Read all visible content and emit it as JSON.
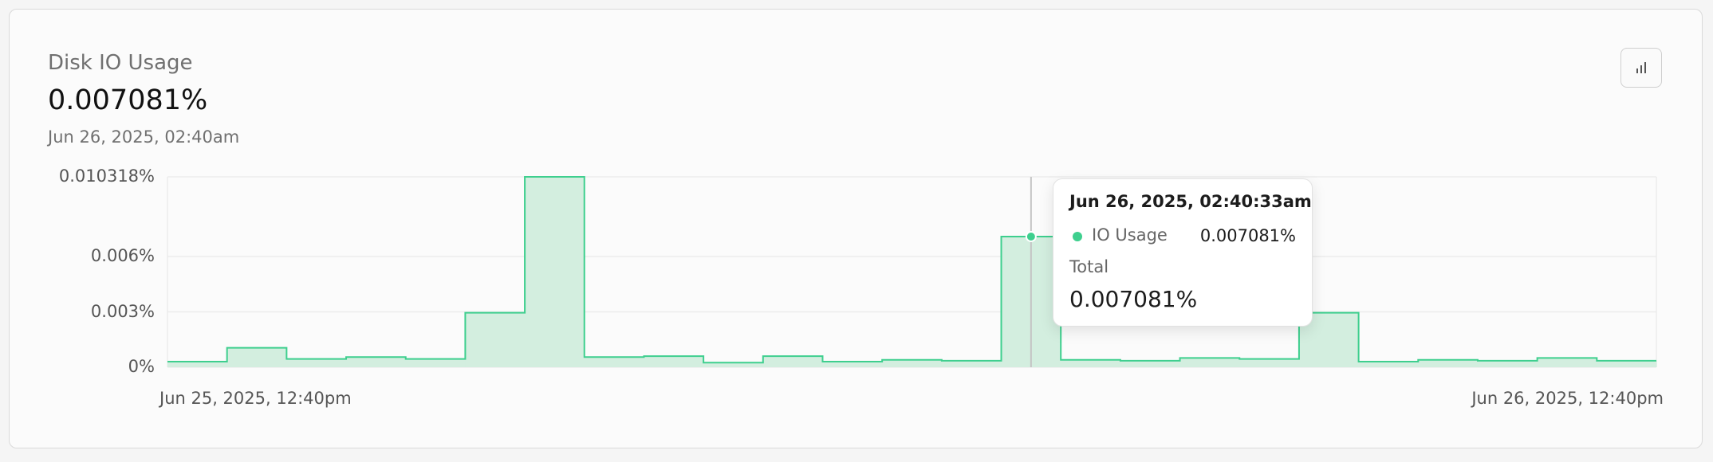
{
  "panel": {
    "title": "Disk IO Usage",
    "current_value": "0.007081%",
    "timestamp": "Jun 26, 2025, 02:40am",
    "chart_toggle_icon": "bar-chart-icon"
  },
  "tooltip": {
    "date": "Jun 26, 2025, 02:40:33am",
    "series_label": "IO Usage",
    "series_value": "0.007081%",
    "total_label": "Total",
    "total_value": "0.007081%"
  },
  "colors": {
    "accent": "#3ecf8e",
    "fill": "#d3eedf",
    "grid": "#ececec"
  },
  "chart_data": {
    "type": "area",
    "step": true,
    "x_start_label": "Jun 25, 2025, 12:40pm",
    "x_end_label": "Jun 26, 2025, 12:40pm",
    "ytick_labels": [
      "0.010318%",
      "0.006%",
      "0.003%",
      "0%"
    ],
    "ytick_values": [
      0.010318,
      0.006,
      0.003,
      0
    ],
    "ylim": [
      0,
      0.010318
    ],
    "grid": true,
    "series": [
      {
        "name": "IO Usage",
        "values": [
          0.0003,
          0.00105,
          0.00045,
          0.00055,
          0.00045,
          0.00295,
          0.010318,
          0.00055,
          0.0006,
          0.00025,
          0.0006,
          0.0003,
          0.0004,
          0.00035,
          0.007081,
          0.0004,
          0.00035,
          0.0005,
          0.00045,
          0.00295,
          0.0003,
          0.0004,
          0.00035,
          0.0005,
          0.00035
        ]
      }
    ],
    "highlight_index": 14
  }
}
